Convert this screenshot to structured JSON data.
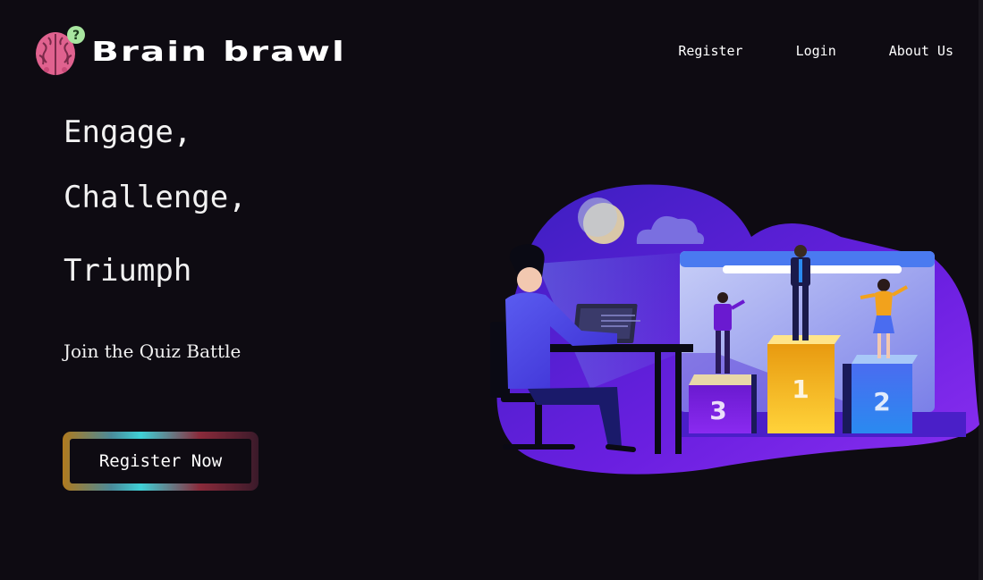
{
  "header": {
    "brand": "Brain brawl",
    "logo_icon": "brain-question-icon",
    "nav": [
      {
        "label": "Register"
      },
      {
        "label": "Login"
      },
      {
        "label": "About Us"
      }
    ]
  },
  "hero": {
    "lines": [
      "Engage,",
      "Challenge,",
      "Triumph"
    ],
    "tagline": "Join the Quiz Battle",
    "cta_label": "Register Now"
  },
  "illustration": {
    "description_icon": "quiz-podium-illustration-icon",
    "podium_numbers": [
      "1",
      "2",
      "3"
    ]
  },
  "colors": {
    "background": "#0e0b12",
    "text": "#ffffff",
    "accent_purple": "#5b1fd6",
    "accent_pink": "#e0628f",
    "accent_gold": "#f2b21c"
  }
}
